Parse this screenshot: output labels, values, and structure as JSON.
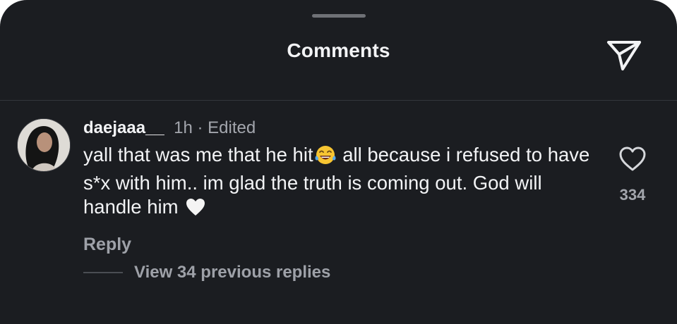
{
  "sheet": {
    "title": "Comments"
  },
  "comment": {
    "username": "daejaaa__",
    "time": "1h",
    "separator": "·",
    "edited": "Edited",
    "text_part1": "yall that was me that he hit",
    "emoji_laugh": "face-with-tears-of-joy-icon",
    "text_part2": " all because i refused to have s*x with him.. im glad the truth is coming out. God will handle him ",
    "emoji_heart": "white-heart-icon",
    "reply_label": "Reply",
    "like_count": "334",
    "view_replies_label": "View 34 previous replies"
  },
  "colors": {
    "background": "#1b1d21",
    "text": "#f2f3f5",
    "muted": "#a3a6ad"
  }
}
